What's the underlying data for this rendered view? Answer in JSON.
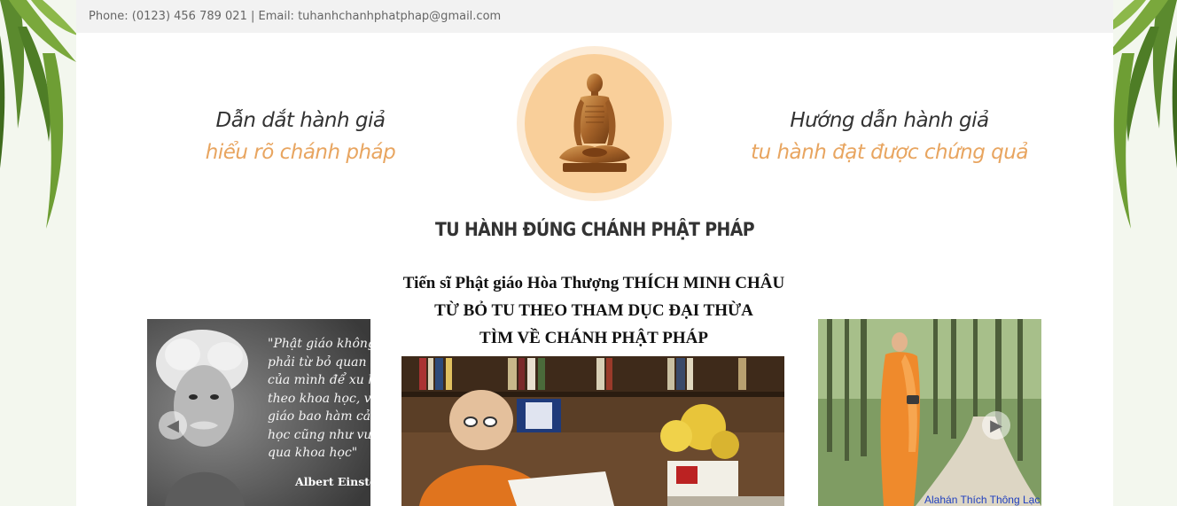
{
  "topbar": {
    "contact": "Phone: (0123) 456 789 021 | Email: tuhanhchanhphatphap@gmail.com"
  },
  "header": {
    "left_tagline": {
      "line1": "Dẫn dắt hành giả",
      "line2": "hiểu rõ chánh pháp"
    },
    "right_tagline": {
      "line1": "Hướng dẫn hành giả",
      "line2": "tu hành đạt được chứng quả"
    },
    "logo_icon": "buddha-statue-icon",
    "site_title": "TU HÀNH ĐÚNG CHÁNH PHẬT PHÁP"
  },
  "slider": {
    "left_slide": {
      "quote_lines": [
        "\"Phật giáo không c",
        "phải từ bỏ quan đi",
        "của mình để xu hư",
        "theo khoa học, vì P",
        "giáo bao hàm cả k",
        "học cũng như vượt",
        "qua khoa học\""
      ],
      "author": "Albert Einstei"
    },
    "center_slide": {
      "heading_lines": [
        "Tiến sĩ Phật giáo Hòa Thượng THÍCH MINH CHÂU",
        "TỪ BỎ TU THEO THAM DỤC ĐẠI THỪA",
        "TÌM VỀ CHÁNH PHẬT PHÁP"
      ]
    },
    "right_slide": {
      "caption": "Alahán Thích Thông Lạc"
    },
    "prev_icon": "arrow-left-icon",
    "next_icon": "arrow-right-icon"
  },
  "colors": {
    "accent": "#e8a560",
    "logo_ring": "#fcebd6",
    "logo_fill": "#f9cf9a",
    "topbar_bg": "#f2f2f2"
  }
}
